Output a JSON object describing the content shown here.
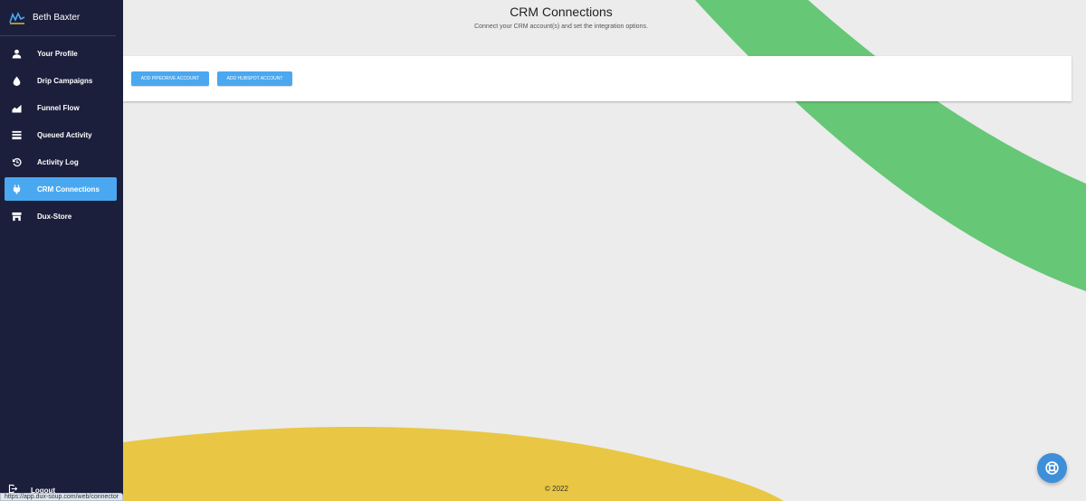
{
  "user": {
    "name": "Beth Baxter"
  },
  "sidebar": {
    "items": [
      {
        "label": "Your Profile",
        "icon": "person-icon",
        "active": false
      },
      {
        "label": "Drip Campaigns",
        "icon": "drop-icon",
        "active": false
      },
      {
        "label": "Funnel Flow",
        "icon": "chart-area-icon",
        "active": false
      },
      {
        "label": "Queued Activity",
        "icon": "stack-icon",
        "active": false
      },
      {
        "label": "Activity Log",
        "icon": "history-icon",
        "active": false
      },
      {
        "label": "CRM Connections",
        "icon": "plug-icon",
        "active": true
      },
      {
        "label": "Dux-Store",
        "icon": "store-icon",
        "active": false
      }
    ],
    "logout_label": "Logout"
  },
  "status_bar": {
    "url": "https://app.dux-soup.com/web/connector"
  },
  "main": {
    "title": "CRM Connections",
    "subtitle": "Connect your CRM account(s) and set the integration options.",
    "buttons": {
      "pipedrive": "ADD PIPEDRIVE ACCOUNT",
      "hubspot": "ADD HUBSPOT ACCOUNT"
    },
    "footer": "© 2022"
  },
  "colors": {
    "sidebar_bg": "#1b1f3b",
    "accent": "#4aa8f0",
    "green_shape": "#66c777",
    "yellow_shape": "#e9c744",
    "page_bg": "#ececec"
  }
}
